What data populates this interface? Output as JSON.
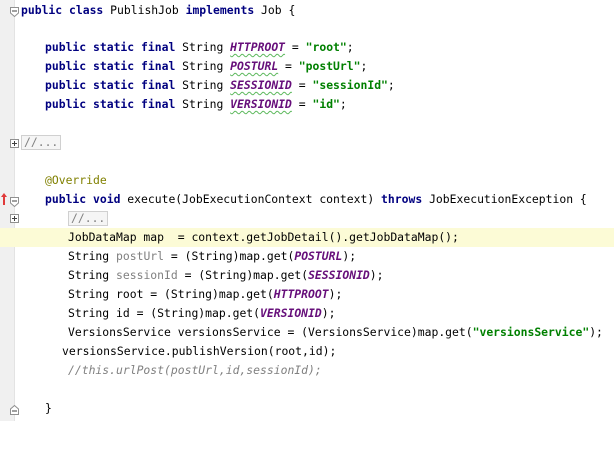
{
  "editor": {
    "lines": [
      {
        "id": "class-decl",
        "tokens": [
          {
            "text": "public class ",
            "cls": "kw"
          },
          {
            "text": "PublishJob ",
            "cls": "plain"
          },
          {
            "text": "implements ",
            "cls": "kw"
          },
          {
            "text": "Job {",
            "cls": "plain"
          }
        ]
      },
      {
        "id": "field-httproot",
        "tokens": [
          {
            "text": "public static final ",
            "cls": "kw"
          },
          {
            "text": "String ",
            "cls": "plain"
          },
          {
            "text": "HTTPROOT",
            "cls": "const-wavy"
          },
          {
            "text": " = ",
            "cls": "plain"
          },
          {
            "text": "\"root\"",
            "cls": "str"
          },
          {
            "text": ";",
            "cls": "plain"
          }
        ]
      },
      {
        "id": "field-posturl",
        "tokens": [
          {
            "text": "public static final ",
            "cls": "kw"
          },
          {
            "text": "String ",
            "cls": "plain"
          },
          {
            "text": "POSTURL",
            "cls": "const-wavy"
          },
          {
            "text": " = ",
            "cls": "plain"
          },
          {
            "text": "\"postUrl\"",
            "cls": "str"
          },
          {
            "text": ";",
            "cls": "plain"
          }
        ]
      },
      {
        "id": "field-sessionid",
        "tokens": [
          {
            "text": "public static final ",
            "cls": "kw"
          },
          {
            "text": "String ",
            "cls": "plain"
          },
          {
            "text": "SESSIONID",
            "cls": "const-wavy"
          },
          {
            "text": " = ",
            "cls": "plain"
          },
          {
            "text": "\"sessionId\"",
            "cls": "str"
          },
          {
            "text": ";",
            "cls": "plain"
          }
        ]
      },
      {
        "id": "field-versionid",
        "tokens": [
          {
            "text": "public static final ",
            "cls": "kw"
          },
          {
            "text": "String ",
            "cls": "plain"
          },
          {
            "text": "VERSIONID",
            "cls": "const-wavy"
          },
          {
            "text": " = ",
            "cls": "plain"
          },
          {
            "text": "\"id\"",
            "cls": "str"
          },
          {
            "text": ";",
            "cls": "plain"
          }
        ]
      },
      {
        "id": "folded-comment-1",
        "tokens": [
          {
            "text": "//...",
            "cls": "fold-text"
          }
        ]
      },
      {
        "id": "override-annotation",
        "tokens": [
          {
            "text": "@Override",
            "cls": "ann"
          }
        ]
      },
      {
        "id": "method-decl",
        "tokens": [
          {
            "text": "public void ",
            "cls": "kw"
          },
          {
            "text": "execute(JobExecutionContext context) ",
            "cls": "plain"
          },
          {
            "text": "throws ",
            "cls": "kw"
          },
          {
            "text": "JobExecutionException {",
            "cls": "plain"
          }
        ]
      },
      {
        "id": "folded-comment-2",
        "tokens": [
          {
            "text": "//...",
            "cls": "fold-text"
          }
        ]
      },
      {
        "id": "datamap-line",
        "tokens": [
          {
            "text": "JobDataMap map  = context.getJobDetail().getJobDataMap();",
            "cls": "plain"
          }
        ]
      },
      {
        "id": "posturl-line",
        "tokens": [
          {
            "text": "String ",
            "cls": "plain"
          },
          {
            "text": "postUrl",
            "cls": "unused"
          },
          {
            "text": " = (String)map.get(",
            "cls": "plain"
          },
          {
            "text": "POSTURL",
            "cls": "const"
          },
          {
            "text": ");",
            "cls": "plain"
          }
        ]
      },
      {
        "id": "sessionid-line",
        "tokens": [
          {
            "text": "String ",
            "cls": "plain"
          },
          {
            "text": "sessionId",
            "cls": "unused"
          },
          {
            "text": " = (String)map.get(",
            "cls": "plain"
          },
          {
            "text": "SESSIONID",
            "cls": "const"
          },
          {
            "text": ");",
            "cls": "plain"
          }
        ]
      },
      {
        "id": "root-line",
        "tokens": [
          {
            "text": "String root = (String)map.get(",
            "cls": "plain"
          },
          {
            "text": "HTTPROOT",
            "cls": "const"
          },
          {
            "text": ");",
            "cls": "plain"
          }
        ]
      },
      {
        "id": "id-line",
        "tokens": [
          {
            "text": "String id = (String)map.get(",
            "cls": "plain"
          },
          {
            "text": "VERSIONID",
            "cls": "const"
          },
          {
            "text": ");",
            "cls": "plain"
          }
        ]
      },
      {
        "id": "service-line",
        "tokens": [
          {
            "text": "VersionsService versionsService = (VersionsService)map.get(",
            "cls": "plain"
          },
          {
            "text": "\"versionsService\"",
            "cls": "str"
          },
          {
            "text": ");",
            "cls": "plain"
          }
        ]
      },
      {
        "id": "publish-line",
        "tokens": [
          {
            "text": "versionsService.publishVersion(root,id);",
            "cls": "plain"
          }
        ]
      },
      {
        "id": "commented-post-line",
        "tokens": [
          {
            "text": "//this.urlPost(postUrl,id,sessionId);",
            "cls": "comment"
          }
        ]
      },
      {
        "id": "method-close",
        "tokens": [
          {
            "text": "}",
            "cls": "plain"
          }
        ]
      }
    ]
  },
  "gutter": {
    "fold_expand_icon": "plus-square-icon",
    "fold_collapse_icon": "minus-pentagon-icon",
    "override_marker_icon": "red-up-arrow-icon"
  },
  "colors": {
    "keyword": "#000080",
    "string": "#008000",
    "constant": "#660e7a",
    "annotation": "#808000",
    "comment": "#808080",
    "current_line": "#fcfbd6",
    "override_marker": "#e03a3a"
  }
}
